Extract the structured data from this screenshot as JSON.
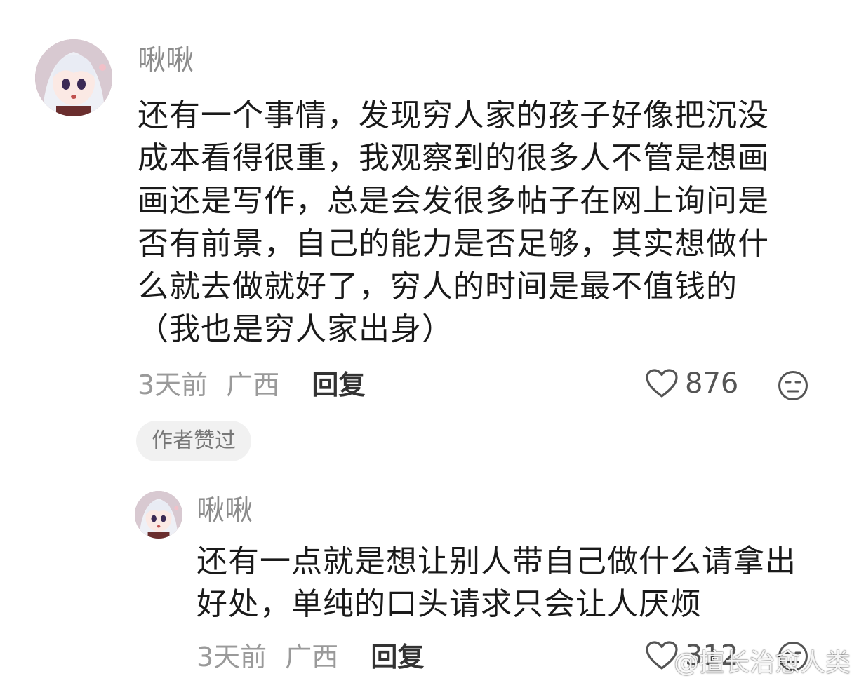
{
  "comment": {
    "username": "啾啾",
    "avatar_icon": "anime-girl-avatar-icon",
    "content_lines": [
      "还有一个事情，发现穷人家的孩子好像把沉没",
      "成本看得很重，我观察到的很多人不管是想画",
      "画还是写作，总是会发很多帖子在网上询问是",
      "否有前景，自己的能力是否足够，其实想做什",
      "么就去做就好了，穷人的时间是最不值钱的",
      "（我也是穷人家出身）"
    ],
    "time": "3天前",
    "location": "广西",
    "reply_label": "回复",
    "likes": "876",
    "badge": "作者赞过"
  },
  "reply": {
    "username": "啾啾",
    "avatar_icon": "anime-girl-avatar-icon",
    "content_lines": [
      "还有一点就是想让别人带自己做什么请拿出",
      "好处，单纯的口头请求只会让人厌烦"
    ],
    "time": "3天前",
    "location": "广西",
    "reply_label": "回复",
    "likes": "312"
  },
  "watermark": "@擅长治愈人类",
  "colors": {
    "text": "#1a1a1a",
    "muted": "#8c8c8c",
    "badge_bg": "#f1f1f1"
  }
}
